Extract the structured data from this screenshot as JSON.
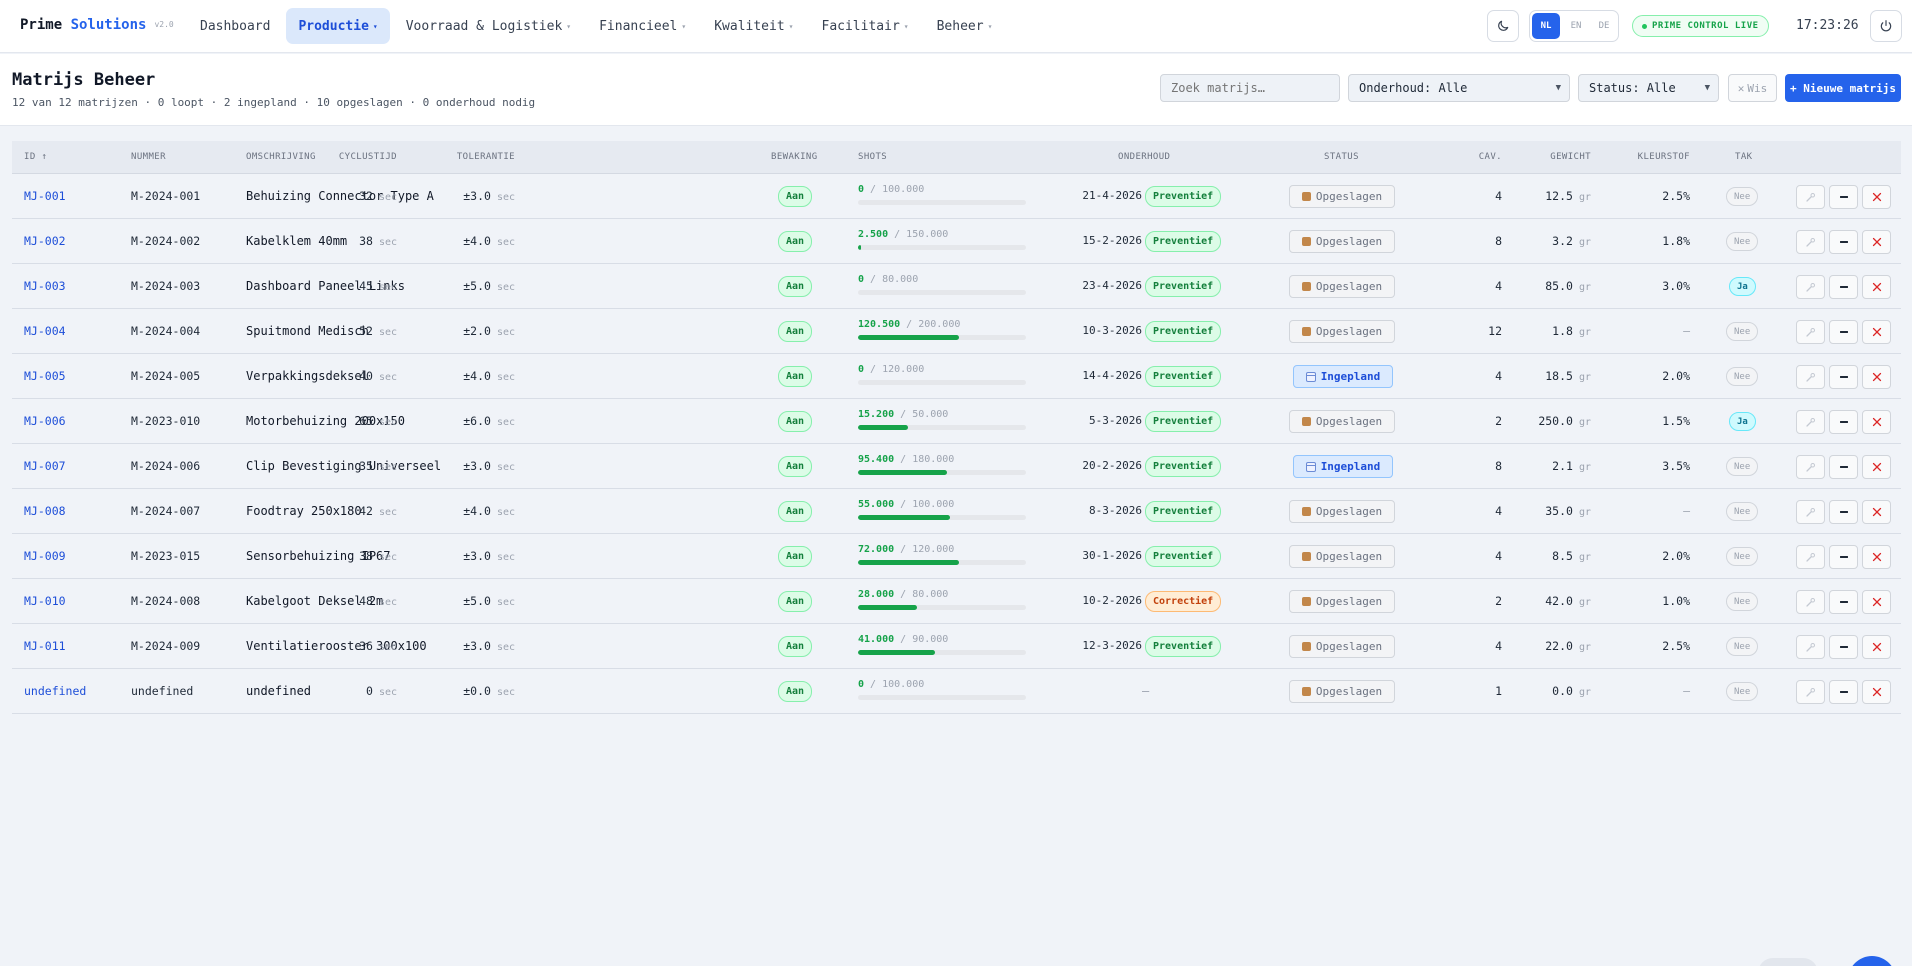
{
  "app": {
    "brand_main": "Prime ",
    "brand_accent": "Solutions",
    "version": "v2.0",
    "live_label": "PRIME CONTROL LIVE",
    "clock": "17:23:26",
    "colors": {
      "accent": "#2563eb",
      "success": "#16a34a",
      "warning": "#c2410c",
      "danger": "#dc2626"
    }
  },
  "nav": {
    "items": [
      {
        "label": "Dashboard",
        "has_menu": false
      },
      {
        "label": "Productie",
        "has_menu": true
      },
      {
        "label": "Voorraad & Logistiek",
        "has_menu": true
      },
      {
        "label": "Financieel",
        "has_menu": true
      },
      {
        "label": "Kwaliteit",
        "has_menu": true
      },
      {
        "label": "Facilitair",
        "has_menu": true
      },
      {
        "label": "Beheer",
        "has_menu": true
      }
    ],
    "active": "Productie"
  },
  "languages": {
    "items": [
      "NL",
      "EN",
      "DE"
    ],
    "active": "NL"
  },
  "icons": {
    "theme": "moon-icon",
    "power": "power-icon",
    "clear": "close-icon",
    "status_stored": "box-icon",
    "status_planned": "calendar-icon",
    "action_1": "wrench-icon",
    "action_2": "minus-icon",
    "action_3": "delete-icon"
  },
  "header": {
    "title": "Matrijs Beheer",
    "summary": "12 van 12 matrijzen · 0 loopt · 2 ingepland · 10 opgeslagen · 0 onderhoud nodig",
    "search_placeholder": "Zoek matrijs…",
    "maintenance_filter": "Onderhoud: Alle",
    "status_filter": "Status: Alle",
    "clear_label": "Wis",
    "new_label": "+ Nieuwe matrijs"
  },
  "table": {
    "columns": {
      "id": "ID ↑",
      "nummer": "NUMMER",
      "omschrijving": "OMSCHRIJVING",
      "cyclustijd": "CYCLUSTIJD",
      "tolerantie": "TOLERANTIE",
      "bewaking": "BEWAKING",
      "shots": "SHOTS",
      "onderhoud": "ONDERHOUD",
      "status": "STATUS",
      "cav": "CAV.",
      "gewicht": "GEWICHT",
      "kleurstof": "KLEURSTOF",
      "tak": "TAK"
    },
    "units": {
      "time": "sec",
      "weight": "gr"
    },
    "rows": [
      {
        "id": "MJ-001",
        "nummer": "M-2024-001",
        "omschrijving": "Behuizing Connector Type A",
        "cyclustijd": "32",
        "tolerantie": "±3.0",
        "bewaking": "Aan",
        "shots": "0",
        "shots_max": "100.000",
        "shots_fraction": 0.0,
        "onderhoud_datum": "21-4-2026",
        "onderhoud_type": "Preventief",
        "status": "Opgeslagen",
        "cav": "4",
        "gewicht": "12.5",
        "kleurstof": "2.5%",
        "tak": "Nee"
      },
      {
        "id": "MJ-002",
        "nummer": "M-2024-002",
        "omschrijving": "Kabelklem 40mm",
        "cyclustijd": "38",
        "tolerantie": "±4.0",
        "bewaking": "Aan",
        "shots": "2.500",
        "shots_max": "150.000",
        "shots_fraction": 0.017,
        "onderhoud_datum": "15-2-2026",
        "onderhoud_type": "Preventief",
        "status": "Opgeslagen",
        "cav": "8",
        "gewicht": "3.2",
        "kleurstof": "1.8%",
        "tak": "Nee"
      },
      {
        "id": "MJ-003",
        "nummer": "M-2024-003",
        "omschrijving": "Dashboard Paneel Links",
        "cyclustijd": "45",
        "tolerantie": "±5.0",
        "bewaking": "Aan",
        "shots": "0",
        "shots_max": "80.000",
        "shots_fraction": 0.0,
        "onderhoud_datum": "23-4-2026",
        "onderhoud_type": "Preventief",
        "status": "Opgeslagen",
        "cav": "4",
        "gewicht": "85.0",
        "kleurstof": "3.0%",
        "tak": "Ja"
      },
      {
        "id": "MJ-004",
        "nummer": "M-2024-004",
        "omschrijving": "Spuitmond Medisch",
        "cyclustijd": "52",
        "tolerantie": "±2.0",
        "bewaking": "Aan",
        "shots": "120.500",
        "shots_max": "200.000",
        "shots_fraction": 0.6,
        "onderhoud_datum": "10-3-2026",
        "onderhoud_type": "Preventief",
        "status": "Opgeslagen",
        "cav": "12",
        "gewicht": "1.8",
        "kleurstof": "—",
        "tak": "Nee"
      },
      {
        "id": "MJ-005",
        "nummer": "M-2024-005",
        "omschrijving": "Verpakkingsdeksel",
        "cyclustijd": "40",
        "tolerantie": "±4.0",
        "bewaking": "Aan",
        "shots": "0",
        "shots_max": "120.000",
        "shots_fraction": 0.0,
        "onderhoud_datum": "14-4-2026",
        "onderhoud_type": "Preventief",
        "status": "Ingepland",
        "cav": "4",
        "gewicht": "18.5",
        "kleurstof": "2.0%",
        "tak": "Nee"
      },
      {
        "id": "MJ-006",
        "nummer": "M-2023-010",
        "omschrijving": "Motorbehuizing 200x150",
        "cyclustijd": "65",
        "tolerantie": "±6.0",
        "bewaking": "Aan",
        "shots": "15.200",
        "shots_max": "50.000",
        "shots_fraction": 0.3,
        "onderhoud_datum": "5-3-2026",
        "onderhoud_type": "Preventief",
        "status": "Opgeslagen",
        "cav": "2",
        "gewicht": "250.0",
        "kleurstof": "1.5%",
        "tak": "Ja"
      },
      {
        "id": "MJ-007",
        "nummer": "M-2024-006",
        "omschrijving": "Clip Bevestiging Universeel",
        "cyclustijd": "35",
        "tolerantie": "±3.0",
        "bewaking": "Aan",
        "shots": "95.400",
        "shots_max": "180.000",
        "shots_fraction": 0.53,
        "onderhoud_datum": "20-2-2026",
        "onderhoud_type": "Preventief",
        "status": "Ingepland",
        "cav": "8",
        "gewicht": "2.1",
        "kleurstof": "3.5%",
        "tak": "Nee"
      },
      {
        "id": "MJ-008",
        "nummer": "M-2024-007",
        "omschrijving": "Foodtray 250x180",
        "cyclustijd": "42",
        "tolerantie": "±4.0",
        "bewaking": "Aan",
        "shots": "55.000",
        "shots_max": "100.000",
        "shots_fraction": 0.55,
        "onderhoud_datum": "8-3-2026",
        "onderhoud_type": "Preventief",
        "status": "Opgeslagen",
        "cav": "4",
        "gewicht": "35.0",
        "kleurstof": "—",
        "tak": "Nee"
      },
      {
        "id": "MJ-009",
        "nummer": "M-2023-015",
        "omschrijving": "Sensorbehuizing IP67",
        "cyclustijd": "38",
        "tolerantie": "±3.0",
        "bewaking": "Aan",
        "shots": "72.000",
        "shots_max": "120.000",
        "shots_fraction": 0.6,
        "onderhoud_datum": "30-1-2026",
        "onderhoud_type": "Preventief",
        "status": "Opgeslagen",
        "cav": "4",
        "gewicht": "8.5",
        "kleurstof": "2.0%",
        "tak": "Nee"
      },
      {
        "id": "MJ-010",
        "nummer": "M-2024-008",
        "omschrijving": "Kabelgoot Deksel 2m",
        "cyclustijd": "48",
        "tolerantie": "±5.0",
        "bewaking": "Aan",
        "shots": "28.000",
        "shots_max": "80.000",
        "shots_fraction": 0.35,
        "onderhoud_datum": "10-2-2026",
        "onderhoud_type": "Correctief",
        "status": "Opgeslagen",
        "cav": "2",
        "gewicht": "42.0",
        "kleurstof": "1.0%",
        "tak": "Nee"
      },
      {
        "id": "MJ-011",
        "nummer": "M-2024-009",
        "omschrijving": "Ventilatierooster 300x100",
        "cyclustijd": "36",
        "tolerantie": "±3.0",
        "bewaking": "Aan",
        "shots": "41.000",
        "shots_max": "90.000",
        "shots_fraction": 0.46,
        "onderhoud_datum": "12-3-2026",
        "onderhoud_type": "Preventief",
        "status": "Opgeslagen",
        "cav": "4",
        "gewicht": "22.0",
        "kleurstof": "2.5%",
        "tak": "Nee"
      },
      {
        "id": "undefined",
        "nummer": "undefined",
        "omschrijving": "undefined",
        "cyclustijd": "0",
        "tolerantie": "±0.0",
        "bewaking": "Aan",
        "shots": "0",
        "shots_max": "100.000",
        "shots_fraction": 0.0,
        "onderhoud_datum": "",
        "onderhoud_type": "",
        "status": "Opgeslagen",
        "cav": "1",
        "gewicht": "0.0",
        "kleurstof": "—",
        "tak": "Nee"
      }
    ]
  }
}
